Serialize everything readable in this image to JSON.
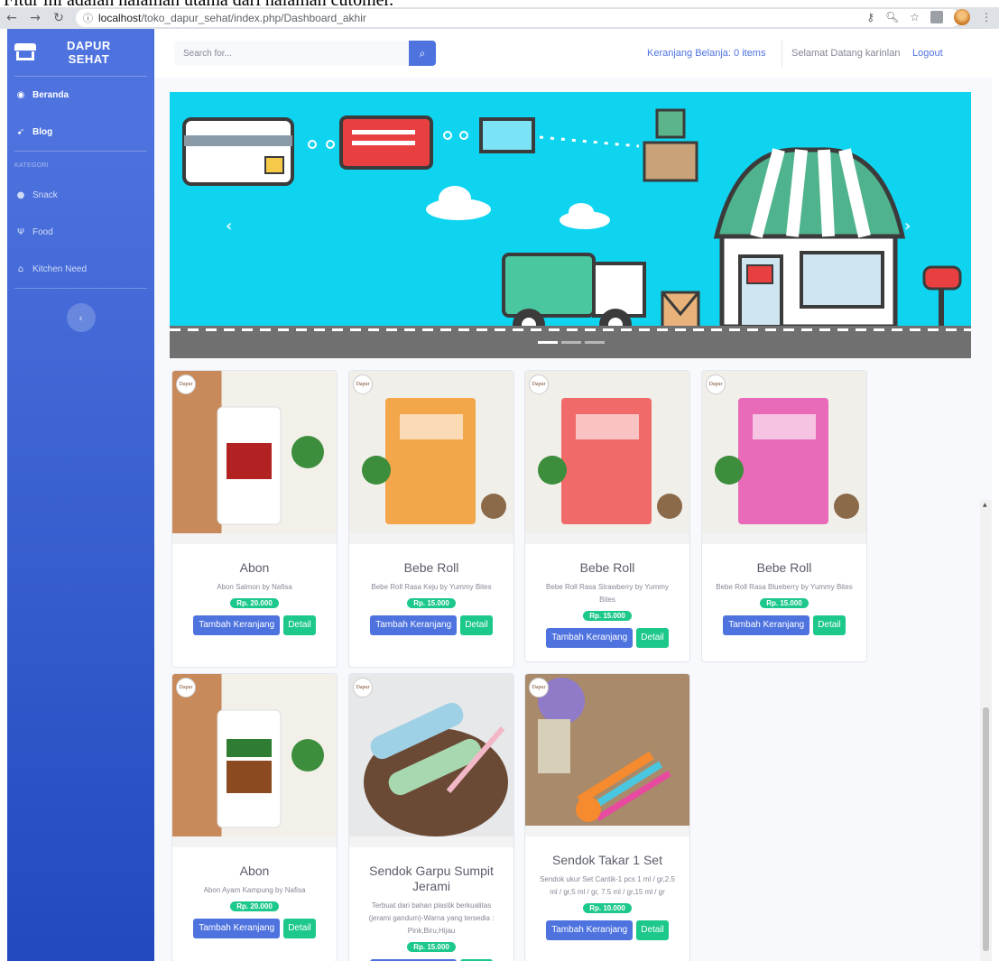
{
  "caption": "Fitur ini adalah halaman utama dari halaman cutomer.",
  "browser": {
    "url_host": "localhost",
    "url_path": "/toko_dapur_sehat/index.php/Dashboard_akhir"
  },
  "sidebar": {
    "brand_line1": "DAPUR",
    "brand_line2": "SEHAT",
    "items": [
      {
        "label": "Beranda",
        "icon": "tachometer-icon"
      },
      {
        "label": "Blog",
        "icon": "blog-icon"
      }
    ],
    "category_heading": "KATEGORI",
    "categories": [
      {
        "label": "Snack",
        "icon": "cookie-icon"
      },
      {
        "label": "Food",
        "icon": "utensils-icon"
      },
      {
        "label": "Kitchen Need",
        "icon": "kitchen-icon"
      }
    ],
    "toggle_icon": "chevron-left-icon"
  },
  "topbar": {
    "search_placeholder": "Search for...",
    "cart_label": "Keranjang Belanja: 0 items",
    "greeting": "Selamat Datang karinlan",
    "logout": "Logout"
  },
  "carousel": {
    "prev_icon": "chevron-left-icon",
    "next_icon": "chevron-right-icon",
    "active_slide": 1,
    "slide_count": 3,
    "bg_color": "#0fd4f0"
  },
  "products": [
    {
      "name": "Abon",
      "desc": "Abon Salmon by Nafisa",
      "price": "Rp. 20.000"
    },
    {
      "name": "Bebe Roll",
      "desc": "Bebe Roll Rasa Keju by Yummy Bites",
      "price": "Rp. 15.000"
    },
    {
      "name": "Bebe Roll",
      "desc": "Bebe Roll Rasa Strawberry by Yummy Bites",
      "price": "Rp. 15.000"
    },
    {
      "name": "Bebe Roll",
      "desc": "Bebe Roll Rasa Blueberry by Yummy Bites",
      "price": "Rp. 15.000"
    },
    {
      "name": "Abon",
      "desc": "Abon Ayam Kampung by Nafisa",
      "price": "Rp. 20.000"
    },
    {
      "name": "Sendok Garpu Sumpit Jerami",
      "desc": "Terbuat dari bahan plastik berkualitas (jerami gandum)-Warna yang tersedia : Pink,Biru,Hijau",
      "price": "Rp. 15.000"
    },
    {
      "name": "Sendok Takar 1 Set",
      "desc": "Sendok ukur Set Cantik-1 pcs 1 ml / gr,2.5 ml / gr,5 ml / gr, 7.5 ml / gr,15 ml / gr",
      "price": "Rp. 10.000"
    }
  ],
  "buttons": {
    "add_cart": "Tambah Keranjang",
    "detail": "Detail"
  },
  "colors": {
    "primary": "#4e73df",
    "success": "#1cc88a",
    "text": "#5a5c69",
    "muted": "#858796"
  }
}
